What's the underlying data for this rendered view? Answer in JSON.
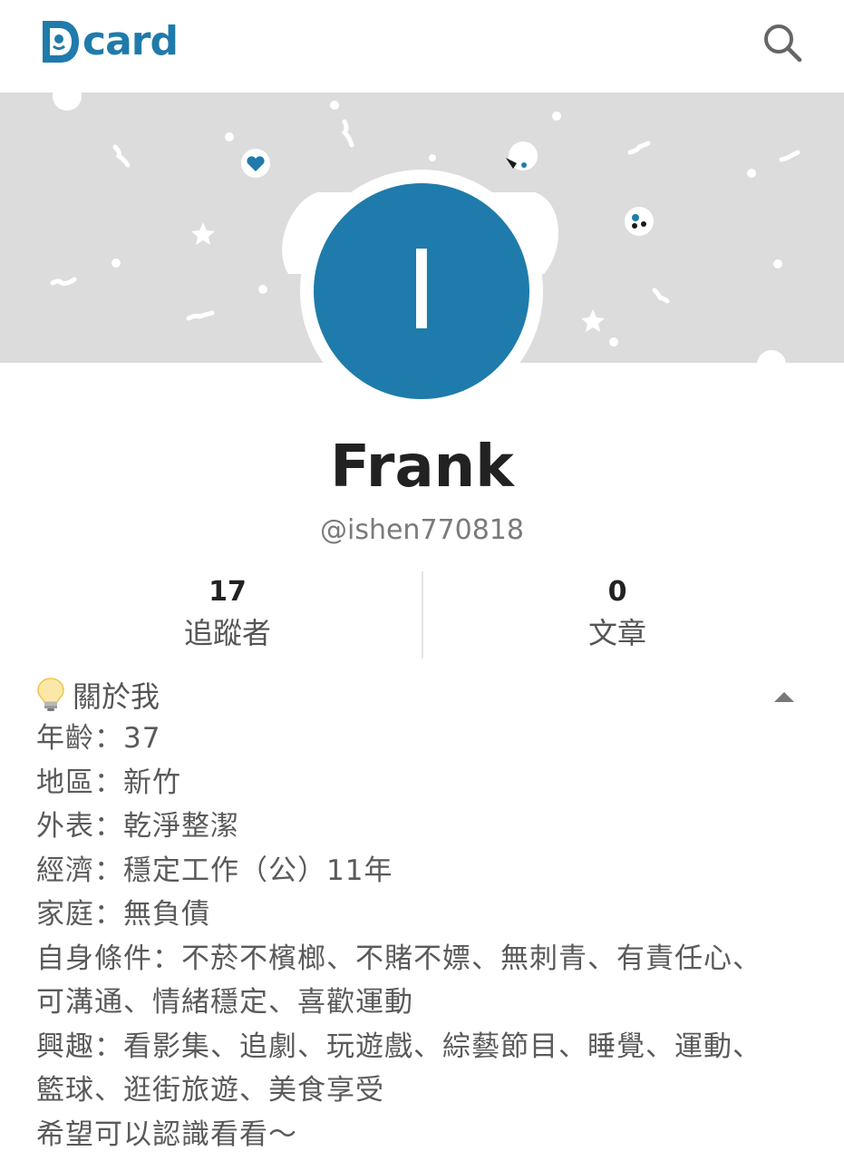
{
  "header": {
    "logo_text": "card",
    "logo_icon": "dcard-logo-icon",
    "search_icon": "search-icon"
  },
  "profile": {
    "avatar_initial": "I",
    "name": "Frank",
    "handle": "@ishen770818"
  },
  "stats": {
    "followers_value": "17",
    "followers_label": "追蹤者",
    "posts_value": "0",
    "posts_label": "文章"
  },
  "about": {
    "title": "關於我",
    "title_icon": "lightbulb-icon",
    "collapse_icon": "chevron-up-icon",
    "lines": [
      "年齡：37",
      "地區：新竹",
      "外表：乾淨整潔",
      "經濟：穩定工作（公）11年",
      "家庭：無負債",
      "自身條件：不菸不檳榔、不賭不嫖、無刺青、有責任心、可溝通、情緒穩定、喜歡運動",
      "興趣：看影集、追劇、玩遊戲、綜藝節目、睡覺、運動、籃球、逛街旅遊、美食享受",
      "希望可以認識看看～"
    ]
  },
  "colors": {
    "brand": "#1f7bab",
    "cover": "#dcdcdc",
    "text_primary": "#222222",
    "text_secondary": "#5a5a5a"
  }
}
